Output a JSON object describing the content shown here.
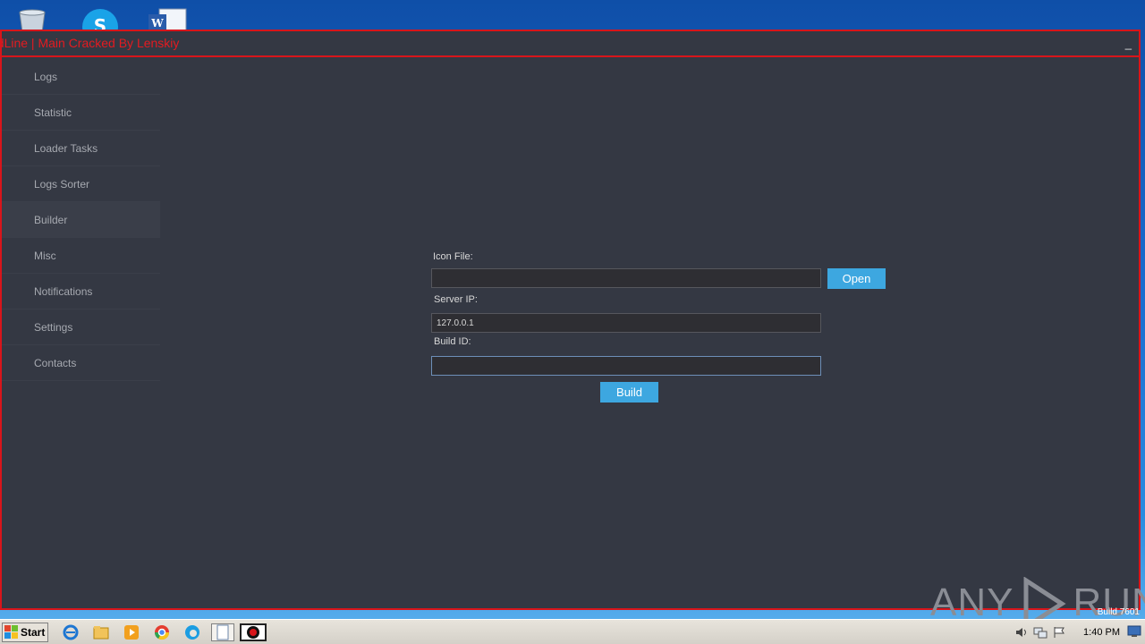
{
  "window": {
    "title": "edLine | Main Cracked By Lenskiy",
    "minimize_label": "_"
  },
  "sidebar": {
    "items": [
      {
        "label": "Logs"
      },
      {
        "label": "Statistic"
      },
      {
        "label": "Loader Tasks"
      },
      {
        "label": "Logs Sorter"
      },
      {
        "label": "Builder",
        "active": true
      },
      {
        "label": "Misc"
      },
      {
        "label": "Notifications"
      },
      {
        "label": "Settings"
      },
      {
        "label": "Contacts"
      }
    ]
  },
  "builder": {
    "icon_file_label": "Icon File:",
    "icon_file_value": "",
    "open_label": "Open",
    "server_ip_label": "Server IP:",
    "server_ip_value": "127.0.0.1",
    "build_id_label": "Build ID:",
    "build_id_value": "",
    "build_label": "Build"
  },
  "watermark": {
    "text_left": "ANY",
    "text_right": "RUN"
  },
  "desktop": {
    "build_stamp": "Build 7601"
  },
  "taskbar": {
    "start_label": "Start",
    "clock": "1:40 PM",
    "icons": [
      "ie-icon",
      "explorer-icon",
      "media-player-icon",
      "chrome-icon",
      "edge-icon",
      "notepad-icon",
      "redline-app-icon"
    ]
  },
  "colors": {
    "accent_red": "#d8151b",
    "panel_bg": "#343843",
    "button_blue": "#3da7e0"
  }
}
